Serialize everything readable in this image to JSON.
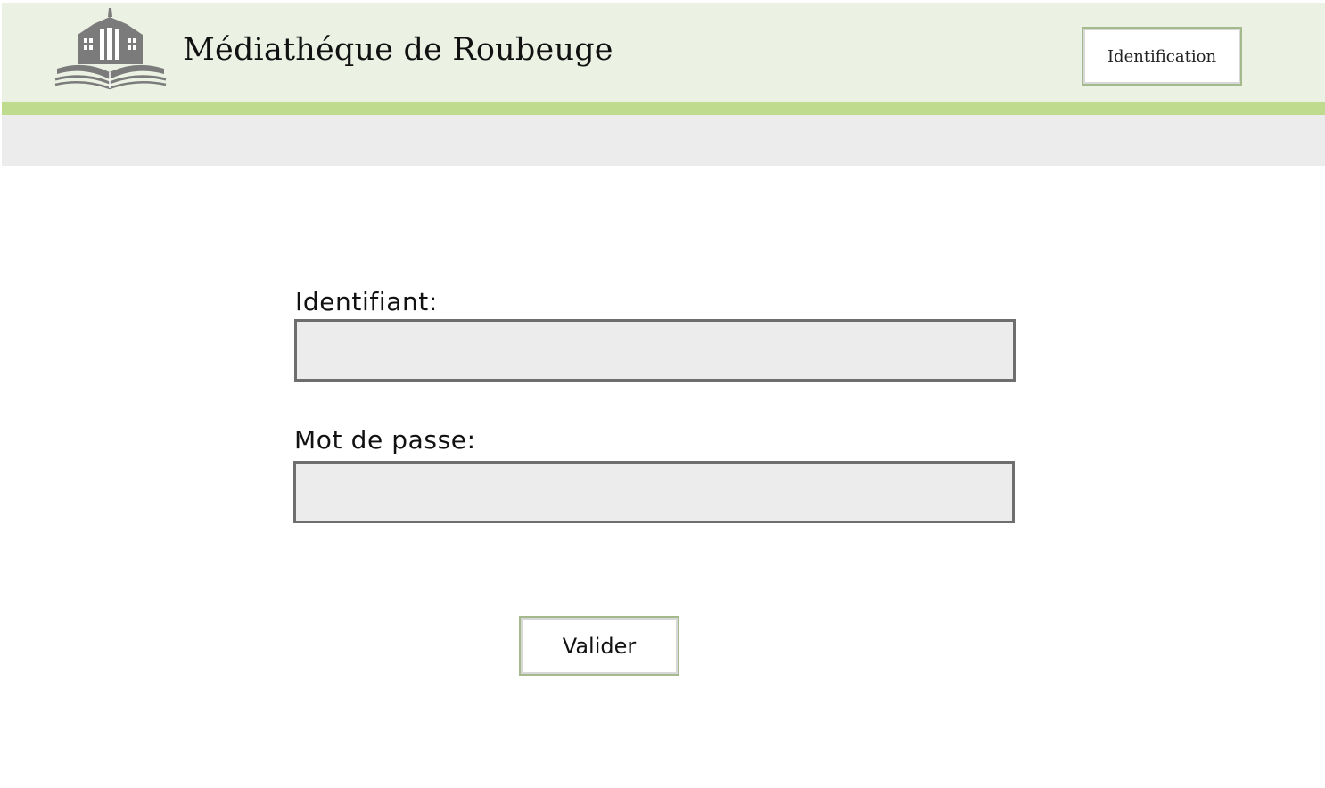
{
  "header": {
    "logo_icon": "library-building-book-icon",
    "title": "Médiathéque de Roubeuge",
    "login_button_label": "Identification"
  },
  "colors": {
    "header_bg": "#ebf1e3",
    "accent_green": "#bfdb8d",
    "button_border": "#a4ba8c",
    "input_bg": "#ececec",
    "input_border": "#6e6e6e",
    "logo_grey": "#7b7b7b"
  },
  "form": {
    "username_label": "Identifiant:",
    "username_value": "",
    "password_label": "Mot de passe:",
    "password_value": "",
    "submit_label": "Valider"
  }
}
